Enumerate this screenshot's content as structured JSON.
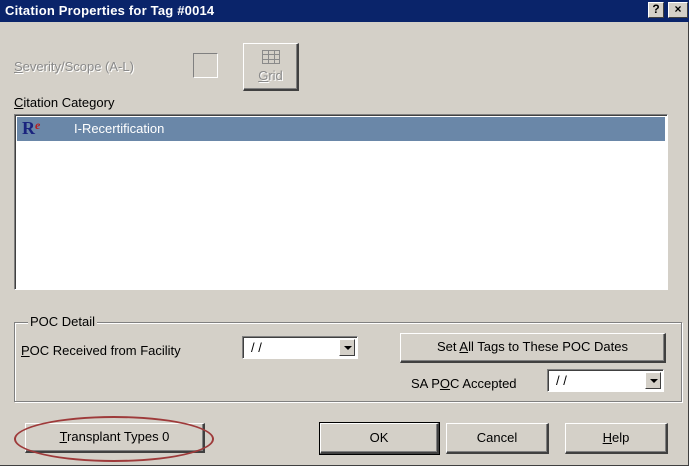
{
  "window": {
    "title": "Citation Properties for Tag #0014",
    "help_btn": "?",
    "close_btn": "×"
  },
  "severity": {
    "label_pre": "",
    "label_u": "S",
    "label_post": "everity/Scope (A-L)"
  },
  "grid_button": {
    "label_u": "G",
    "label_post": "rid"
  },
  "citation_category": {
    "label_u": "C",
    "label_post": "itation Category",
    "items": [
      {
        "code": "R",
        "label": "I-Recertification"
      }
    ]
  },
  "poc_detail": {
    "group_label": "POC Detail",
    "received_label_u": "P",
    "received_label_post": "OC Received from Facility",
    "received_value": "/ /",
    "set_all_pre": "Set ",
    "set_all_u": "A",
    "set_all_post": "ll Tags to These POC Dates",
    "sa_pre": "SA P",
    "sa_u": "O",
    "sa_post": "C Accepted",
    "sa_value": "/ /"
  },
  "buttons": {
    "transplant_u": "T",
    "transplant_post": "ransplant Types 0",
    "ok": "OK",
    "cancel": "Cancel",
    "help_u": "H",
    "help_post": "elp"
  },
  "colors": {
    "highlight_circle": "#9e3a3a",
    "title_bar": "#0a246a",
    "selection": "#6a87a8"
  }
}
